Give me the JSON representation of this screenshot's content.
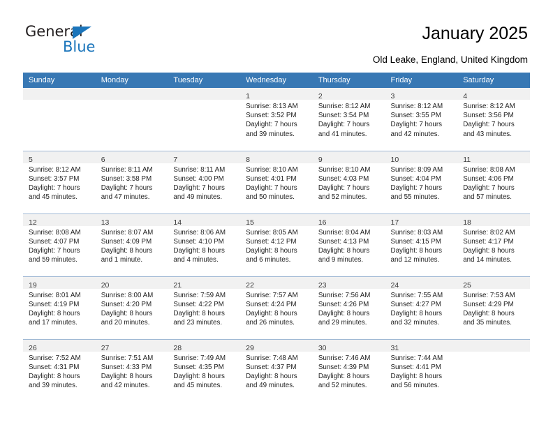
{
  "brand": {
    "name_part1": "General",
    "name_part2": "Blue",
    "accent_color": "#1b75bb"
  },
  "header": {
    "title": "January 2025",
    "location": "Old Leake, England, United Kingdom"
  },
  "theme": {
    "header_row_bg": "#3878b4",
    "daynum_band_bg": "#f1f1f1",
    "row_divider": "#9fb8d4"
  },
  "weekday_headers": [
    "Sunday",
    "Monday",
    "Tuesday",
    "Wednesday",
    "Thursday",
    "Friday",
    "Saturday"
  ],
  "weeks": [
    [
      {
        "day": "",
        "lines": [
          "",
          "",
          "",
          ""
        ]
      },
      {
        "day": "",
        "lines": [
          "",
          "",
          "",
          ""
        ]
      },
      {
        "day": "",
        "lines": [
          "",
          "",
          "",
          ""
        ]
      },
      {
        "day": "1",
        "lines": [
          "Sunrise: 8:13 AM",
          "Sunset: 3:52 PM",
          "Daylight: 7 hours",
          "and 39 minutes."
        ]
      },
      {
        "day": "2",
        "lines": [
          "Sunrise: 8:12 AM",
          "Sunset: 3:54 PM",
          "Daylight: 7 hours",
          "and 41 minutes."
        ]
      },
      {
        "day": "3",
        "lines": [
          "Sunrise: 8:12 AM",
          "Sunset: 3:55 PM",
          "Daylight: 7 hours",
          "and 42 minutes."
        ]
      },
      {
        "day": "4",
        "lines": [
          "Sunrise: 8:12 AM",
          "Sunset: 3:56 PM",
          "Daylight: 7 hours",
          "and 43 minutes."
        ]
      }
    ],
    [
      {
        "day": "5",
        "lines": [
          "Sunrise: 8:12 AM",
          "Sunset: 3:57 PM",
          "Daylight: 7 hours",
          "and 45 minutes."
        ]
      },
      {
        "day": "6",
        "lines": [
          "Sunrise: 8:11 AM",
          "Sunset: 3:58 PM",
          "Daylight: 7 hours",
          "and 47 minutes."
        ]
      },
      {
        "day": "7",
        "lines": [
          "Sunrise: 8:11 AM",
          "Sunset: 4:00 PM",
          "Daylight: 7 hours",
          "and 49 minutes."
        ]
      },
      {
        "day": "8",
        "lines": [
          "Sunrise: 8:10 AM",
          "Sunset: 4:01 PM",
          "Daylight: 7 hours",
          "and 50 minutes."
        ]
      },
      {
        "day": "9",
        "lines": [
          "Sunrise: 8:10 AM",
          "Sunset: 4:03 PM",
          "Daylight: 7 hours",
          "and 52 minutes."
        ]
      },
      {
        "day": "10",
        "lines": [
          "Sunrise: 8:09 AM",
          "Sunset: 4:04 PM",
          "Daylight: 7 hours",
          "and 55 minutes."
        ]
      },
      {
        "day": "11",
        "lines": [
          "Sunrise: 8:08 AM",
          "Sunset: 4:06 PM",
          "Daylight: 7 hours",
          "and 57 minutes."
        ]
      }
    ],
    [
      {
        "day": "12",
        "lines": [
          "Sunrise: 8:08 AM",
          "Sunset: 4:07 PM",
          "Daylight: 7 hours",
          "and 59 minutes."
        ]
      },
      {
        "day": "13",
        "lines": [
          "Sunrise: 8:07 AM",
          "Sunset: 4:09 PM",
          "Daylight: 8 hours",
          "and 1 minute."
        ]
      },
      {
        "day": "14",
        "lines": [
          "Sunrise: 8:06 AM",
          "Sunset: 4:10 PM",
          "Daylight: 8 hours",
          "and 4 minutes."
        ]
      },
      {
        "day": "15",
        "lines": [
          "Sunrise: 8:05 AM",
          "Sunset: 4:12 PM",
          "Daylight: 8 hours",
          "and 6 minutes."
        ]
      },
      {
        "day": "16",
        "lines": [
          "Sunrise: 8:04 AM",
          "Sunset: 4:13 PM",
          "Daylight: 8 hours",
          "and 9 minutes."
        ]
      },
      {
        "day": "17",
        "lines": [
          "Sunrise: 8:03 AM",
          "Sunset: 4:15 PM",
          "Daylight: 8 hours",
          "and 12 minutes."
        ]
      },
      {
        "day": "18",
        "lines": [
          "Sunrise: 8:02 AM",
          "Sunset: 4:17 PM",
          "Daylight: 8 hours",
          "and 14 minutes."
        ]
      }
    ],
    [
      {
        "day": "19",
        "lines": [
          "Sunrise: 8:01 AM",
          "Sunset: 4:19 PM",
          "Daylight: 8 hours",
          "and 17 minutes."
        ]
      },
      {
        "day": "20",
        "lines": [
          "Sunrise: 8:00 AM",
          "Sunset: 4:20 PM",
          "Daylight: 8 hours",
          "and 20 minutes."
        ]
      },
      {
        "day": "21",
        "lines": [
          "Sunrise: 7:59 AM",
          "Sunset: 4:22 PM",
          "Daylight: 8 hours",
          "and 23 minutes."
        ]
      },
      {
        "day": "22",
        "lines": [
          "Sunrise: 7:57 AM",
          "Sunset: 4:24 PM",
          "Daylight: 8 hours",
          "and 26 minutes."
        ]
      },
      {
        "day": "23",
        "lines": [
          "Sunrise: 7:56 AM",
          "Sunset: 4:26 PM",
          "Daylight: 8 hours",
          "and 29 minutes."
        ]
      },
      {
        "day": "24",
        "lines": [
          "Sunrise: 7:55 AM",
          "Sunset: 4:27 PM",
          "Daylight: 8 hours",
          "and 32 minutes."
        ]
      },
      {
        "day": "25",
        "lines": [
          "Sunrise: 7:53 AM",
          "Sunset: 4:29 PM",
          "Daylight: 8 hours",
          "and 35 minutes."
        ]
      }
    ],
    [
      {
        "day": "26",
        "lines": [
          "Sunrise: 7:52 AM",
          "Sunset: 4:31 PM",
          "Daylight: 8 hours",
          "and 39 minutes."
        ]
      },
      {
        "day": "27",
        "lines": [
          "Sunrise: 7:51 AM",
          "Sunset: 4:33 PM",
          "Daylight: 8 hours",
          "and 42 minutes."
        ]
      },
      {
        "day": "28",
        "lines": [
          "Sunrise: 7:49 AM",
          "Sunset: 4:35 PM",
          "Daylight: 8 hours",
          "and 45 minutes."
        ]
      },
      {
        "day": "29",
        "lines": [
          "Sunrise: 7:48 AM",
          "Sunset: 4:37 PM",
          "Daylight: 8 hours",
          "and 49 minutes."
        ]
      },
      {
        "day": "30",
        "lines": [
          "Sunrise: 7:46 AM",
          "Sunset: 4:39 PM",
          "Daylight: 8 hours",
          "and 52 minutes."
        ]
      },
      {
        "day": "31",
        "lines": [
          "Sunrise: 7:44 AM",
          "Sunset: 4:41 PM",
          "Daylight: 8 hours",
          "and 56 minutes."
        ]
      },
      {
        "day": "",
        "lines": [
          "",
          "",
          "",
          ""
        ]
      }
    ]
  ]
}
